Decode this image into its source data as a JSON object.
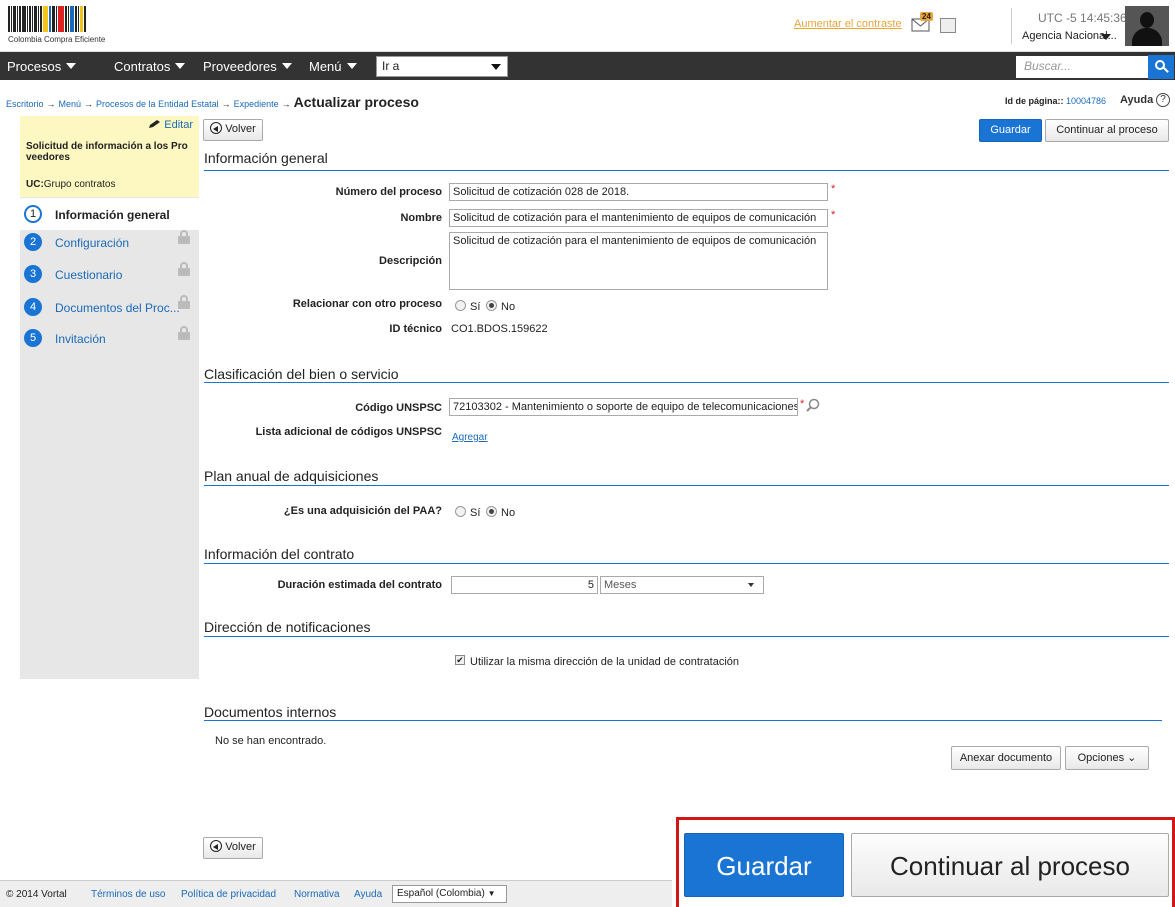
{
  "header": {
    "logo_text": "Colombia Compra Eficiente",
    "contrast_link": "Aumentar el contraste",
    "mail_badge": "24",
    "utc_label": "UTC -5",
    "time": "14:45:36",
    "agency": "Agencia Nacional..."
  },
  "nav": {
    "items": [
      "Procesos",
      "Contratos",
      "Proveedores",
      "Menú"
    ],
    "goto_value": "Ir a",
    "search_placeholder": "Buscar..."
  },
  "breadcrumb": {
    "items": [
      "Escritorio",
      "Menú",
      "Procesos de la Entidad Estatal",
      "Expediente"
    ],
    "separator": "→",
    "current": "Actualizar proceso",
    "page_id_label": "Id de página::",
    "page_id": "10004786",
    "help_label": "Ayuda",
    "help_icon": "?"
  },
  "sidebar": {
    "edit_label": "Editar",
    "title": "Solicitud de información a los Pro veedores",
    "uc_label": "UC:",
    "uc_value": "Grupo contratos",
    "steps": [
      {
        "num": "1",
        "label": "Información general",
        "locked": false,
        "active": true
      },
      {
        "num": "2",
        "label": "Configuración",
        "locked": true
      },
      {
        "num": "3",
        "label": "Cuestionario",
        "locked": true
      },
      {
        "num": "4",
        "label": "Documentos del Proc...",
        "locked": true
      },
      {
        "num": "5",
        "label": "Invitación",
        "locked": true
      }
    ]
  },
  "toolbar": {
    "back_label": "Volver",
    "save_label": "Guardar",
    "continue_label": "Continuar al proceso"
  },
  "general": {
    "title": "Información general",
    "numero_label": "Número del proceso",
    "numero_value": "Solicitud de cotización 028 de 2018.",
    "nombre_label": "Nombre",
    "nombre_value": "Solicitud de cotización para el mantenimiento de equipos de comunicación",
    "descripcion_label": "Descripción",
    "descripcion_value": "Solicitud de cotización para el mantenimiento de equipos de comunicación",
    "relacionar_label": "Relacionar con otro proceso",
    "si_label": "Sí",
    "no_label": "No",
    "relacionar_selected": "No",
    "id_label": "ID técnico",
    "id_value": "CO1.BDOS.159622",
    "required_mark": "*"
  },
  "clasificacion": {
    "title": "Clasificación del bien o servicio",
    "unspsc_label": "Código UNSPSC",
    "unspsc_value": "72103302 - Mantenimiento o soporte de equipo de telecomunicaciones",
    "lista_label": "Lista adicional de códigos UNSPSC",
    "agregar_link": "Agregar"
  },
  "plan": {
    "title": "Plan anual de adquisiciones",
    "paa_label": "¿Es una adquisición del PAA?",
    "si_label": "Sí",
    "no_label": "No",
    "selected": "No"
  },
  "contrato": {
    "title": "Información del contrato",
    "duracion_label": "Duración estimada del contrato",
    "duracion_value": "5",
    "unidad_value": "Meses"
  },
  "notificaciones": {
    "title": "Dirección de notificaciones",
    "checkbox_label": "Utilizar la misma dirección de la unidad de contratación",
    "checked": true
  },
  "documentos": {
    "title": "Documentos internos",
    "empty_text": "No se han encontrado.",
    "anexar_label": "Anexar documento",
    "opciones_label": "Opciones"
  },
  "footer": {
    "copyright": "© 2014 Vortal",
    "links": [
      "Términos de uso",
      "Política de privacidad",
      "Normativa",
      "Ayuda"
    ],
    "language": "Español (Colombia)"
  },
  "callout": {
    "save_label": "Guardar",
    "continue_label": "Continuar al proceso",
    "border_color": "#d01616"
  },
  "colors": {
    "primary": "#1a74d4",
    "link": "#1a6ab8",
    "nav_bg": "#333333",
    "sidebar_info_bg": "#fdf7c1",
    "accent_orange": "#e8a53a"
  }
}
